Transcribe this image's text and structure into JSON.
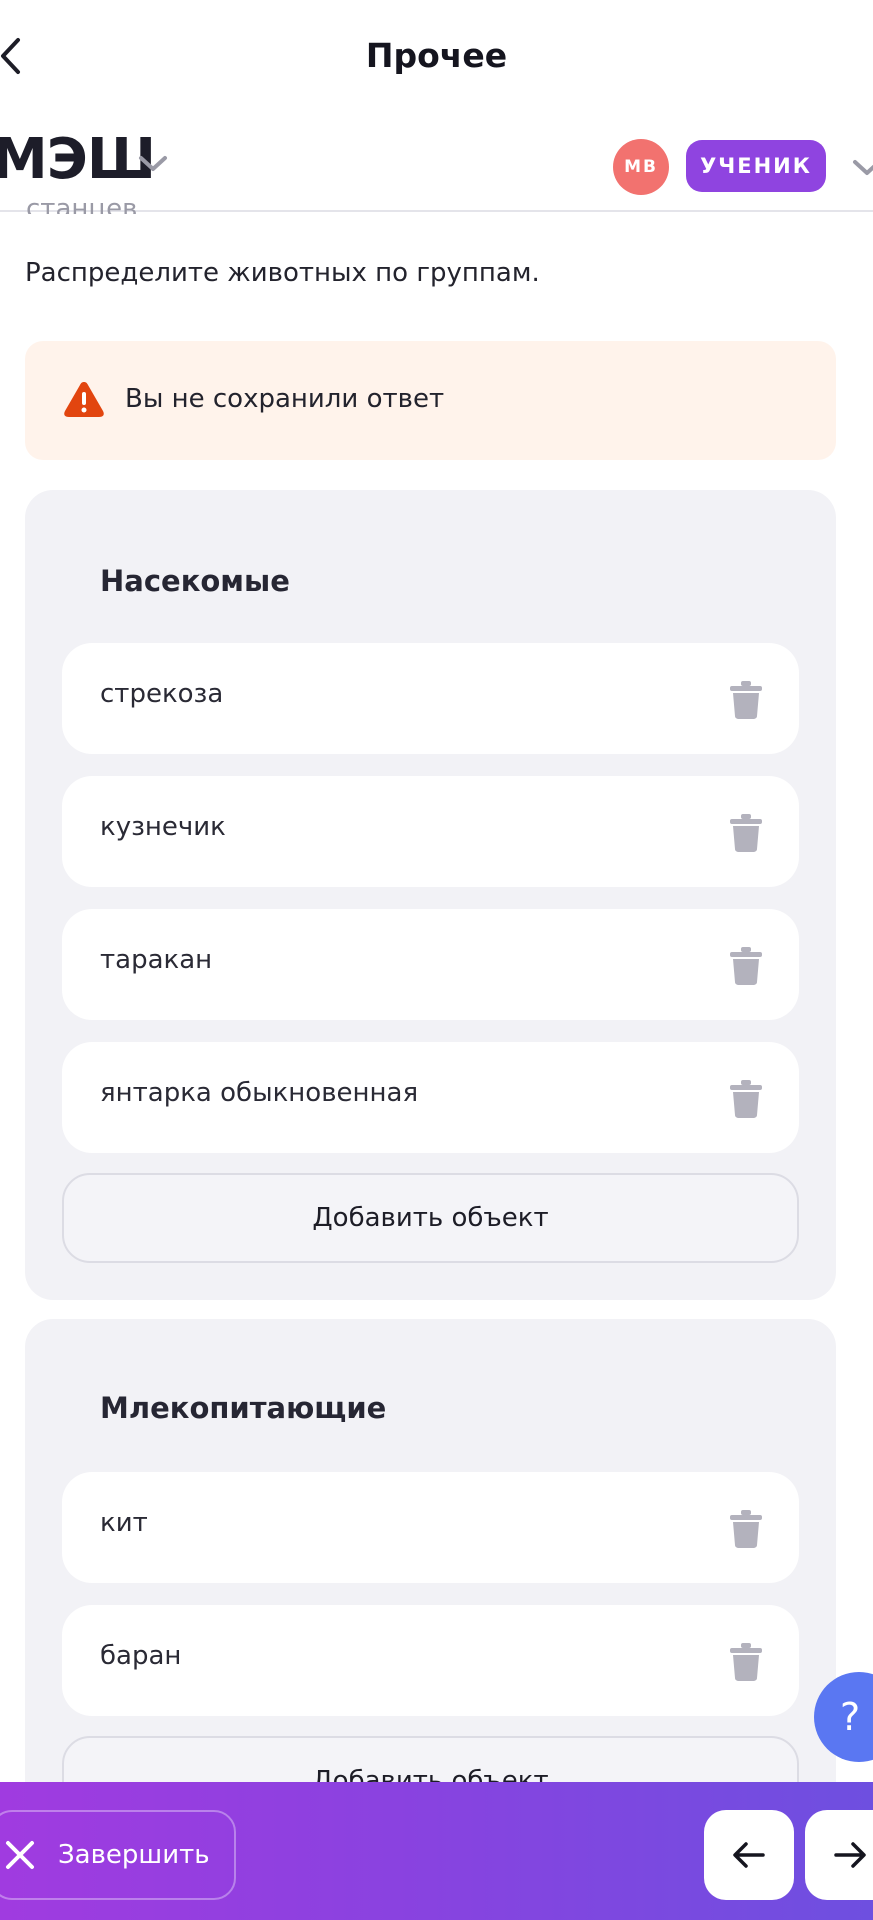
{
  "topbar": {
    "title": "Прочее",
    "back_icon": "chevron-left-icon"
  },
  "header": {
    "logo_text": "МЭШ",
    "avatar_initials": "МВ",
    "role_label": "УЧЕНИК",
    "colors": {
      "avatar": "#f2726f",
      "role_badge": "#8f44e0"
    }
  },
  "task": {
    "cut_text": "станцев",
    "instruction": "Распределите животных по группам.",
    "warning_text": "Вы не сохранили ответ",
    "warning_icon": "warning-triangle-icon"
  },
  "groups": [
    {
      "title": "Насекомые",
      "items": [
        "стрекоза",
        "кузнечик",
        "таракан",
        "янтарка обыкновенная"
      ],
      "add_label": "Добавить объект"
    },
    {
      "title": "Млекопитающие",
      "items": [
        "кит",
        "баран"
      ],
      "add_label": "Добавить объект"
    }
  ],
  "help": {
    "label": "?"
  },
  "bottom_bar": {
    "finish_label": "Завершить",
    "prev_icon": "arrow-left-icon",
    "next_icon": "arrow-right-icon"
  }
}
